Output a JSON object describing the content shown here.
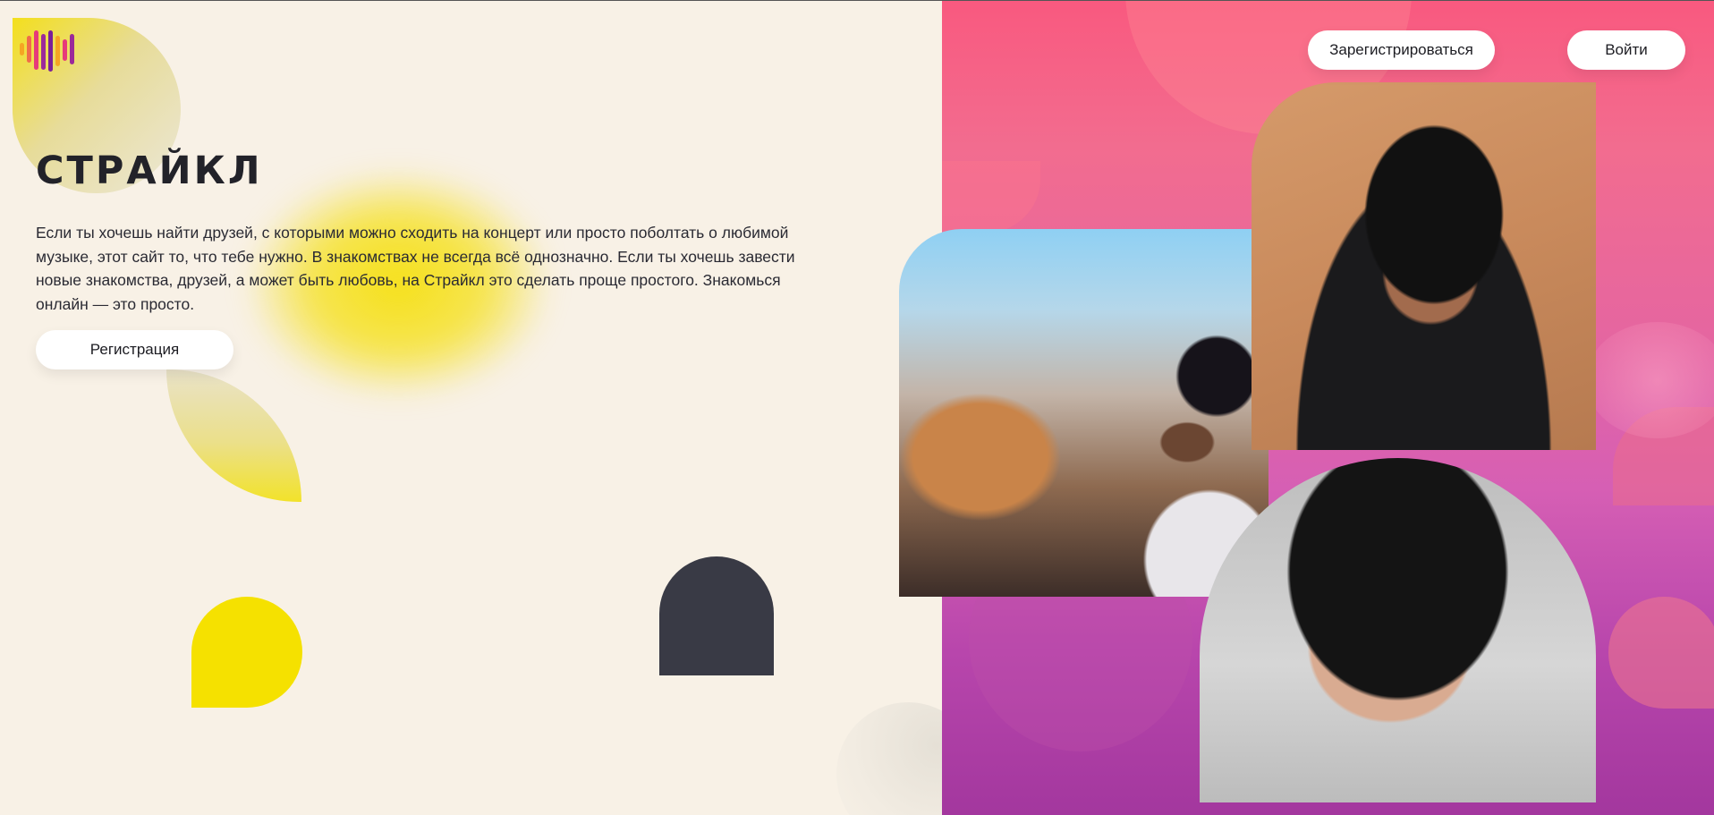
{
  "brand": {
    "title": "СТРАЙКЛ",
    "logo_icon": "sound-wave-logo-icon"
  },
  "hero": {
    "description": "Если ты хочешь найти друзей, с которыми можно сходить на концерт или просто поболтать о любимой музыке, этот сайт то, что тебе нужно. В знакомствах не всегда всё однозначно. Если ты хочешь завести новые знакомства, друзей, а может быть любовь, на Страйкл это сделать проще простого. Знакомься онлайн — это просто.",
    "register_button": "Регистрация"
  },
  "header": {
    "signup_button": "Зарегистрироваться",
    "login_button": "Войти"
  },
  "colors": {
    "background_left": "#f8f1e6",
    "accent_yellow": "#f5e100",
    "accent_dark": "#393a45",
    "gradient_pink": "#f9597f",
    "gradient_purple": "#a3379e",
    "text_dark": "#222229"
  },
  "photos": [
    {
      "name": "smiling-woman-photo"
    },
    {
      "name": "man-in-hat-sunglasses-photo"
    },
    {
      "name": "curly-man-in-hat-photo"
    }
  ]
}
